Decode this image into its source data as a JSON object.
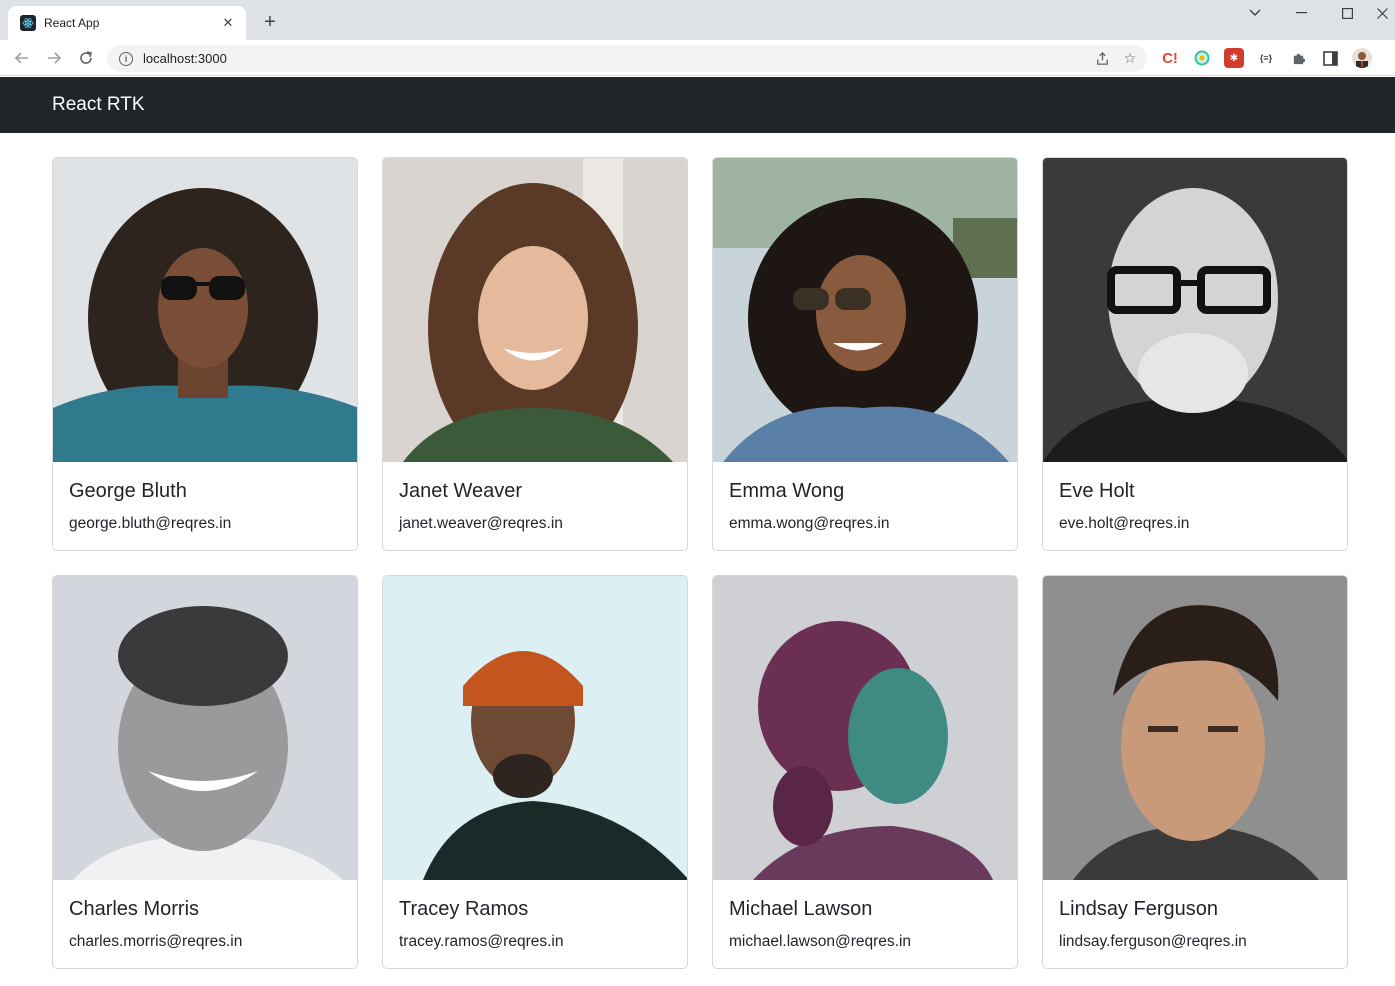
{
  "browser": {
    "tab_title": "React App",
    "url": "localhost:3000"
  },
  "app": {
    "brand": "React RTK"
  },
  "colors": {
    "navbar": "#212529",
    "text": "#212529"
  },
  "users": [
    {
      "name": "George Bluth",
      "email": "george.bluth@reqres.in"
    },
    {
      "name": "Janet Weaver",
      "email": "janet.weaver@reqres.in"
    },
    {
      "name": "Emma Wong",
      "email": "emma.wong@reqres.in"
    },
    {
      "name": "Eve Holt",
      "email": "eve.holt@reqres.in"
    },
    {
      "name": "Charles Morris",
      "email": "charles.morris@reqres.in"
    },
    {
      "name": "Tracey Ramos",
      "email": "tracey.ramos@reqres.in"
    },
    {
      "name": "Michael Lawson",
      "email": "michael.lawson@reqres.in"
    },
    {
      "name": "Lindsay Ferguson",
      "email": "lindsay.ferguson@reqres.in"
    }
  ]
}
